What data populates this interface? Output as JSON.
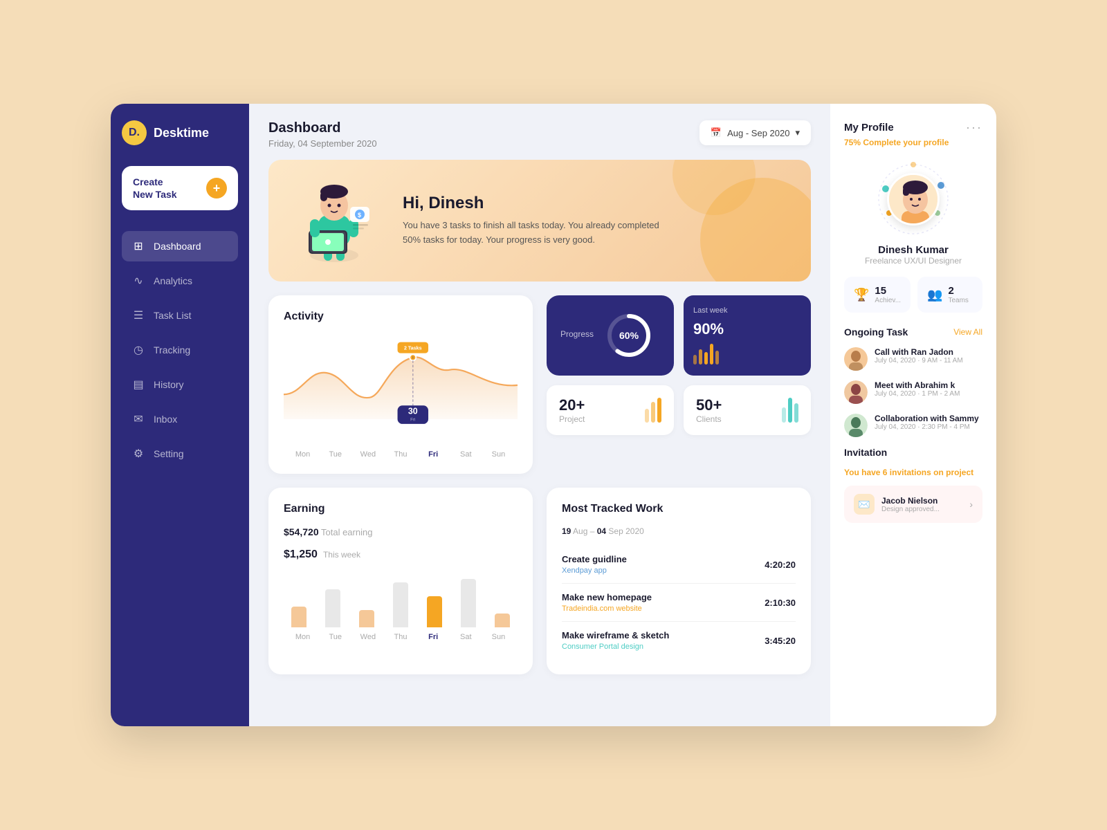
{
  "sidebar": {
    "logo": "D.",
    "app_name": "Desktime",
    "create_task_label": "Create\nNew Task",
    "create_plus": "+",
    "nav_items": [
      {
        "id": "dashboard",
        "label": "Dashboard",
        "icon": "⊞",
        "active": true
      },
      {
        "id": "analytics",
        "label": "Analytics",
        "icon": "∿"
      },
      {
        "id": "task-list",
        "label": "Task List",
        "icon": "☰"
      },
      {
        "id": "tracking",
        "label": "Tracking",
        "icon": "◷"
      },
      {
        "id": "history",
        "label": "History",
        "icon": "▤"
      },
      {
        "id": "inbox",
        "label": "Inbox",
        "icon": "✉"
      },
      {
        "id": "setting",
        "label": "Setting",
        "icon": "⚙"
      }
    ]
  },
  "header": {
    "title": "Dashboard",
    "date": "Friday, 04 September 2020",
    "date_range": "Aug - Sep 2020"
  },
  "welcome": {
    "greeting": "Hi, ",
    "name": "Dinesh",
    "message": "You have 3 tasks to finish all tasks today. You already completed 50% tasks for today. Your progress is very good."
  },
  "activity": {
    "title": "Activity",
    "days": [
      "Mon",
      "Tue",
      "Wed",
      "Thu",
      "Fri",
      "Sat",
      "Sun"
    ],
    "active_day": "Fri",
    "active_value": "30",
    "tooltip_tasks": "2 Tasks"
  },
  "progress": {
    "title": "Progress",
    "percent": 60,
    "last_week_percent": 90,
    "last_week_label": "Last week"
  },
  "projects_stat": {
    "value": "20+",
    "label": "Project"
  },
  "clients_stat": {
    "value": "50+",
    "label": "Clients"
  },
  "earning": {
    "title": "Earning",
    "total_label": "Total earning",
    "total_value": "$54,720",
    "this_week_label": "This week",
    "this_week_value": "$1,250",
    "days": [
      "Mon",
      "Tue",
      "Wed",
      "Thu",
      "Fri",
      "Sat",
      "Sun"
    ],
    "bars": [
      30,
      55,
      25,
      65,
      45,
      70,
      20
    ]
  },
  "most_tracked": {
    "title": "Most Tracked Work",
    "range_label": "19 Aug – 04 Sep 2020",
    "range_start": "19",
    "range_end": "04 Sep 2020",
    "items": [
      {
        "name": "Create guidline",
        "sub": "Xendpay app",
        "time": "4:20:20",
        "color": "blue"
      },
      {
        "name": "Make new homepage",
        "sub": "Tradeindia.com website",
        "time": "2:10:30",
        "color": "orange"
      },
      {
        "name": "Make wireframe & sketch",
        "sub": "Consumer Portal design",
        "time": "3:45:20",
        "color": "teal"
      }
    ]
  },
  "profile": {
    "title": "My Profile",
    "complete_pct": "75%",
    "complete_label": "Complete your profile",
    "name": "Dinesh Kumar",
    "role": "Freelance UX/UI Designer",
    "achievements": "15",
    "achievements_label": "Achiev...",
    "teams": "2",
    "teams_label": "Teams"
  },
  "ongoing_tasks": {
    "title": "Ongoing Task",
    "view_all": "View All",
    "items": [
      {
        "name": "Call with Ran Jadon",
        "date": "July 04, 2020",
        "time": "9 AM - 11 AM",
        "avatar_color": "#b87d4b"
      },
      {
        "name": "Meet with Abrahim k",
        "date": "July 04, 2020",
        "time": "1 PM - 2 AM",
        "avatar_color": "#8b4444"
      },
      {
        "name": "Collaboration with Sammy",
        "date": "July 04, 2020",
        "time": "2:30 PM - 4 PM",
        "avatar_color": "#4a7a5a"
      }
    ]
  },
  "invitation": {
    "title": "Invitation",
    "text_before": "You have ",
    "count": "6 invitations",
    "text_after": " on project",
    "card_name": "Jacob Nielson",
    "card_sub": "Design approved..."
  }
}
